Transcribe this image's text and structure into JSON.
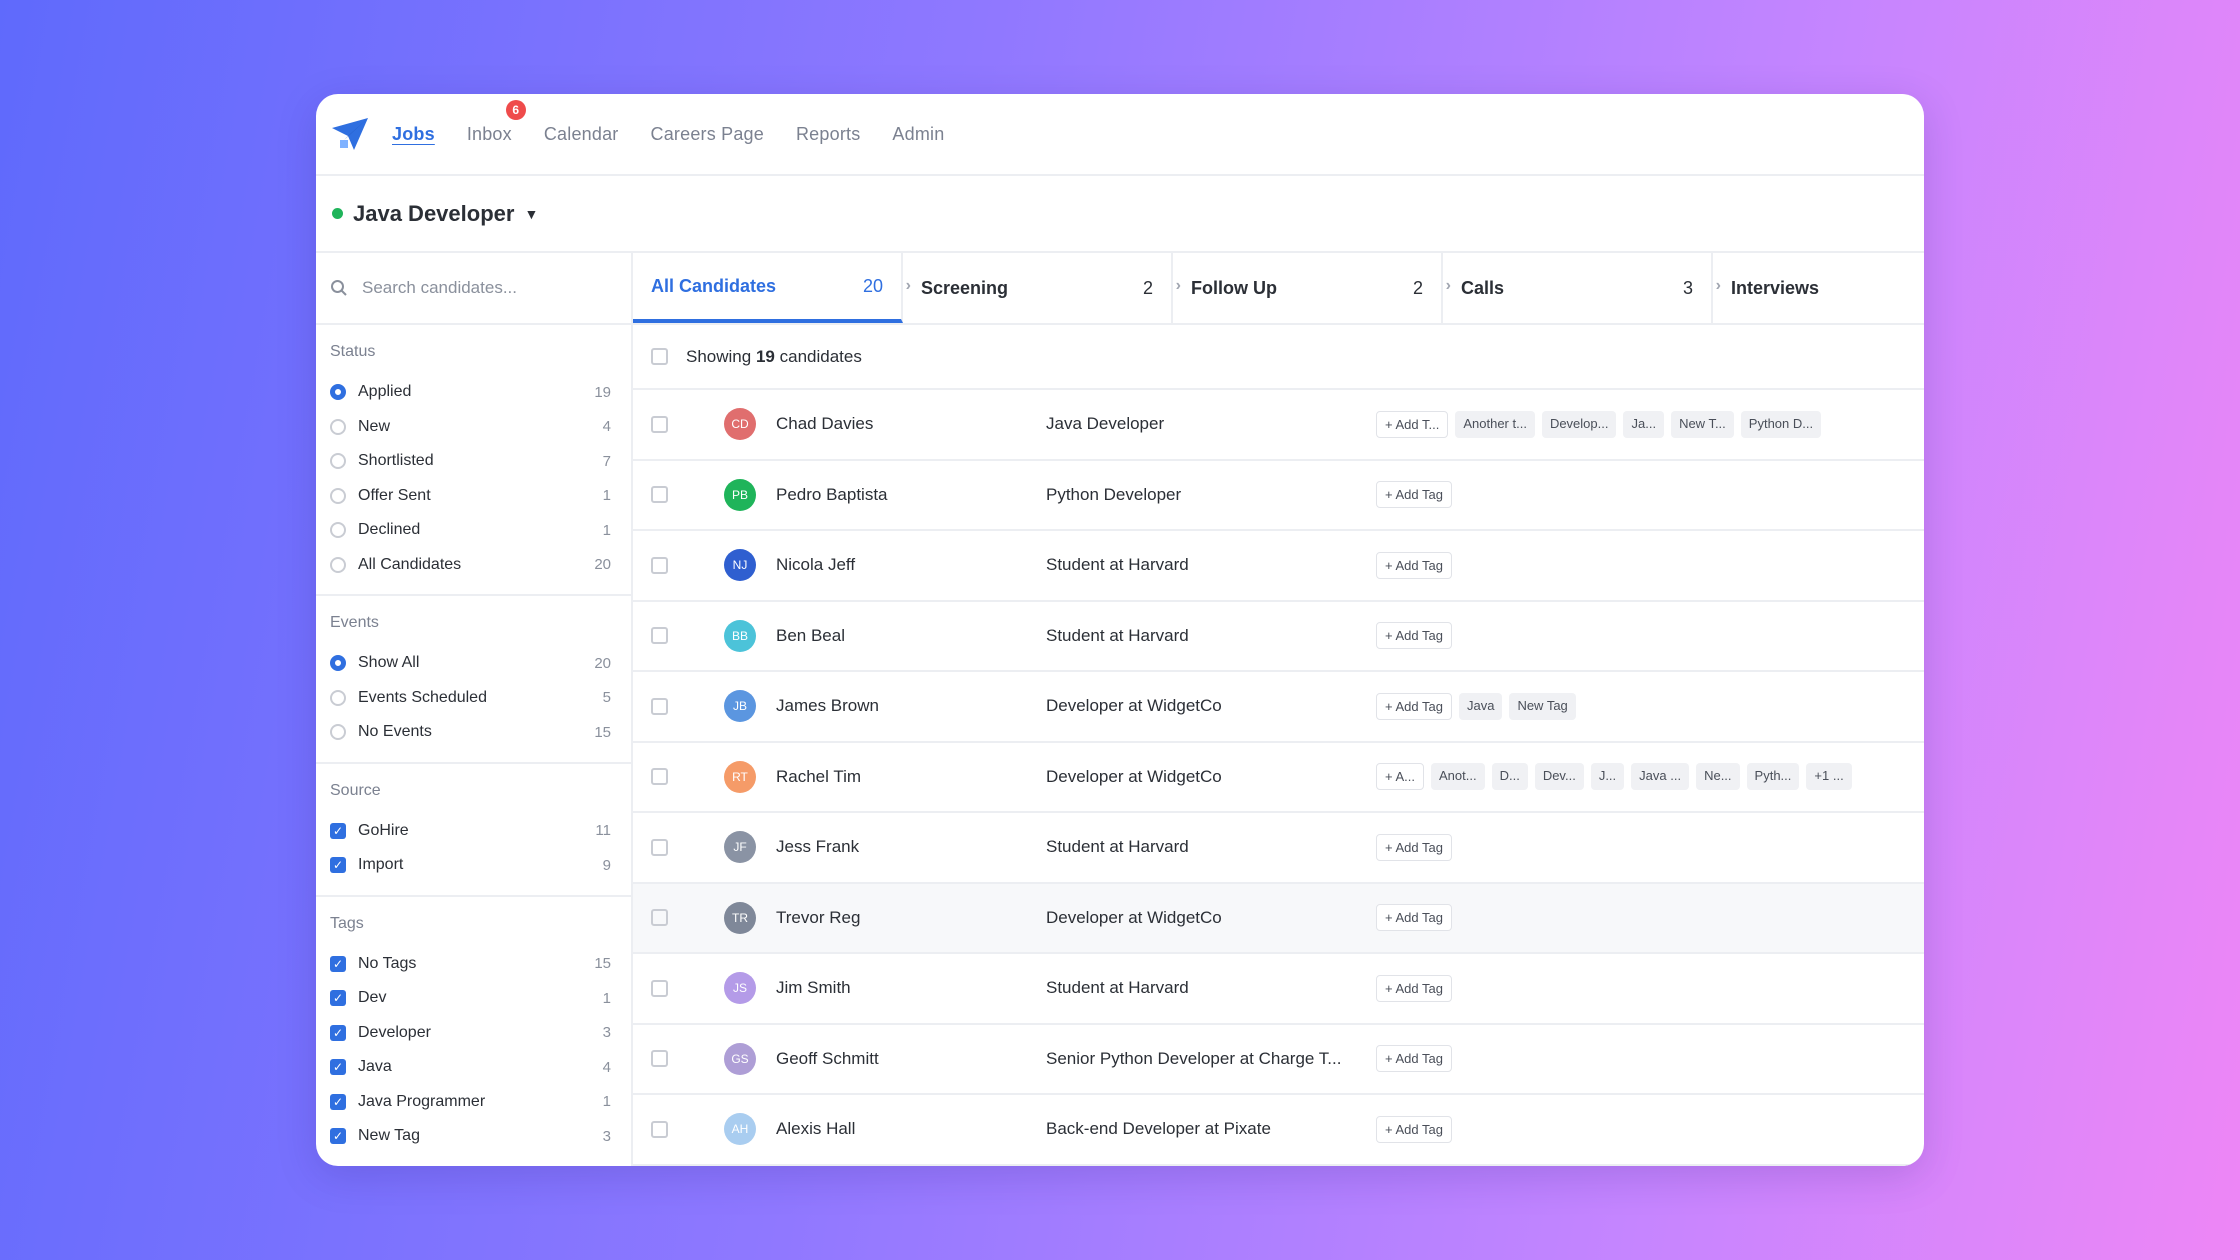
{
  "nav": {
    "items": [
      "Jobs",
      "Inbox",
      "Calendar",
      "Careers Page",
      "Reports",
      "Admin"
    ],
    "inbox_badge": "6"
  },
  "job": {
    "title": "Java Developer"
  },
  "search": {
    "placeholder": "Search candidates..."
  },
  "filters": {
    "status": {
      "title": "Status",
      "options": [
        {
          "label": "Applied",
          "count": "19"
        },
        {
          "label": "New",
          "count": "4"
        },
        {
          "label": "Shortlisted",
          "count": "7"
        },
        {
          "label": "Offer Sent",
          "count": "1"
        },
        {
          "label": "Declined",
          "count": "1"
        },
        {
          "label": "All Candidates",
          "count": "20"
        }
      ]
    },
    "events": {
      "title": "Events",
      "options": [
        {
          "label": "Show All",
          "count": "20"
        },
        {
          "label": "Events Scheduled",
          "count": "5"
        },
        {
          "label": "No Events",
          "count": "15"
        }
      ]
    },
    "source": {
      "title": "Source",
      "options": [
        {
          "label": "GoHire",
          "count": "11"
        },
        {
          "label": "Import",
          "count": "9"
        }
      ]
    },
    "tags": {
      "title": "Tags",
      "options": [
        {
          "label": "No Tags",
          "count": "15"
        },
        {
          "label": "Dev",
          "count": "1"
        },
        {
          "label": "Developer",
          "count": "3"
        },
        {
          "label": "Java",
          "count": "4"
        },
        {
          "label": "Java Programmer",
          "count": "1"
        },
        {
          "label": "New Tag",
          "count": "3"
        }
      ]
    }
  },
  "tabs": [
    {
      "label": "All Candidates",
      "count": "20"
    },
    {
      "label": "Screening",
      "count": "2"
    },
    {
      "label": "Follow Up",
      "count": "2"
    },
    {
      "label": "Calls",
      "count": "3"
    },
    {
      "label": "Interviews",
      "count": ""
    }
  ],
  "showing": {
    "prefix": "Showing ",
    "count": "19",
    "suffix": " candidates"
  },
  "candidates": [
    {
      "initials": "CD",
      "color": "#e06e6e",
      "name": "Chad Davies",
      "title": "Java Developer",
      "tags": [
        "+ Add T...",
        "Another t...",
        "Develop...",
        "Ja...",
        "New T...",
        "Python D..."
      ]
    },
    {
      "initials": "PB",
      "color": "#1fb45a",
      "name": "Pedro Baptista",
      "title": "Python Developer",
      "tags": [
        "+ Add Tag"
      ]
    },
    {
      "initials": "NJ",
      "color": "#2f5fd0",
      "name": "Nicola Jeff",
      "title": "Student at Harvard",
      "tags": [
        "+ Add Tag"
      ]
    },
    {
      "initials": "BB",
      "color": "#4cc3d9",
      "name": "Ben Beal",
      "title": "Student at Harvard",
      "tags": [
        "+ Add Tag"
      ]
    },
    {
      "initials": "JB",
      "color": "#5b96e0",
      "name": "James Brown",
      "title": "Developer at WidgetCo",
      "tags": [
        "+ Add Tag",
        "Java",
        "New Tag"
      ]
    },
    {
      "initials": "RT",
      "color": "#f59b68",
      "name": "Rachel Tim",
      "title": "Developer at WidgetCo",
      "tags": [
        "+ A...",
        "Anot...",
        "D...",
        "Dev...",
        "J...",
        "Java ...",
        "Ne...",
        "Pyth...",
        "+1 ..."
      ]
    },
    {
      "initials": "JF",
      "color": "#8a93a4",
      "name": "Jess Frank",
      "title": "Student at Harvard",
      "tags": [
        "+ Add Tag"
      ]
    },
    {
      "initials": "TR",
      "color": "#7f8899",
      "name": "Trevor Reg",
      "title": "Developer at WidgetCo",
      "tags": [
        "+ Add Tag"
      ]
    },
    {
      "initials": "JS",
      "color": "#b49be8",
      "name": "Jim Smith",
      "title": "Student at Harvard",
      "tags": [
        "+ Add Tag"
      ]
    },
    {
      "initials": "GS",
      "color": "#ae9ed6",
      "name": "Geoff Schmitt",
      "title": "Senior Python Developer at Charge T...",
      "tags": [
        "+ Add Tag"
      ]
    },
    {
      "initials": "AH",
      "color": "#a9cdf0",
      "name": "Alexis Hall",
      "title": "Back-end Developer at Pixate",
      "tags": [
        "+ Add Tag"
      ]
    }
  ]
}
